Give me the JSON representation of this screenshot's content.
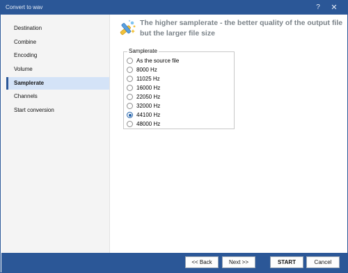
{
  "window": {
    "title": "Convert to wav",
    "help_glyph": "?",
    "close_glyph": "✕"
  },
  "sidebar": {
    "items": [
      {
        "label": "Destination"
      },
      {
        "label": "Combine"
      },
      {
        "label": "Encoding"
      },
      {
        "label": "Volume"
      },
      {
        "label": "Samplerate",
        "active": true
      },
      {
        "label": "Channels"
      },
      {
        "label": "Start conversion"
      }
    ]
  },
  "content": {
    "header_text": "The higher samplerate - the better quality of the output file but the larger file size",
    "group_label": "Samplerate",
    "options": [
      {
        "label": "As the source file",
        "checked": false
      },
      {
        "label": "8000 Hz",
        "checked": false
      },
      {
        "label": "11025 Hz",
        "checked": false
      },
      {
        "label": "16000 Hz",
        "checked": false
      },
      {
        "label": "22050 Hz",
        "checked": false
      },
      {
        "label": "32000 Hz",
        "checked": false
      },
      {
        "label": "44100 Hz",
        "checked": true
      },
      {
        "label": "48000 Hz",
        "checked": false
      }
    ]
  },
  "footer": {
    "back_label": "<< Back",
    "next_label": "Next >>",
    "start_label": "START",
    "cancel_label": "Cancel"
  },
  "colors": {
    "accent": "#2b5797",
    "selected_bg": "#d4e3f7",
    "header_text": "#7a8288"
  },
  "icons": {
    "header": "wand-icon",
    "help": "help-icon",
    "close": "close-icon"
  }
}
